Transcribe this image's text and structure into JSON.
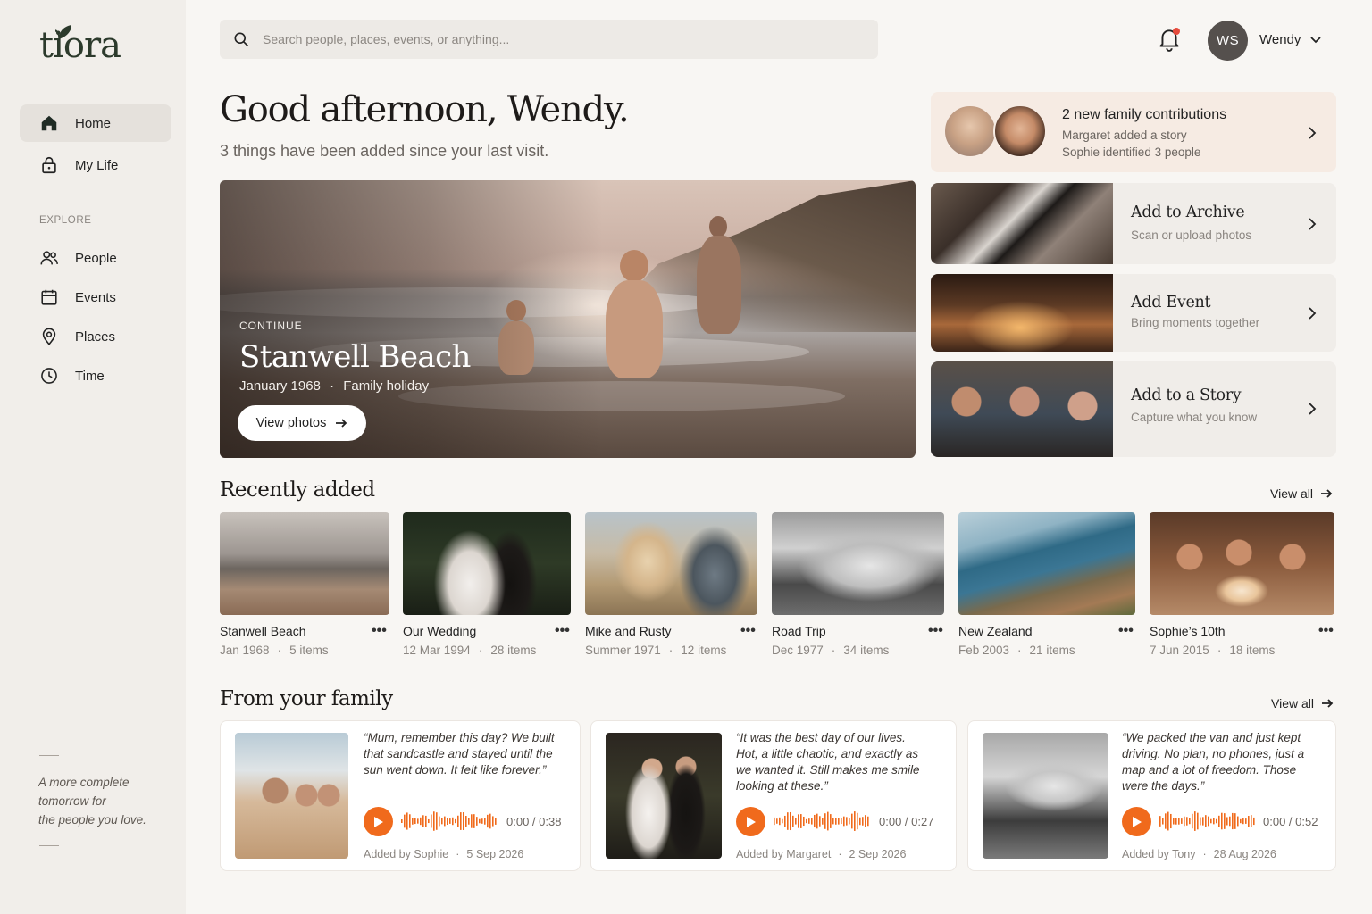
{
  "app": {
    "logo": "tiora"
  },
  "sidebar": {
    "items": [
      {
        "label": "Home",
        "icon": "home-icon"
      },
      {
        "label": "My Life",
        "icon": "lock-icon"
      }
    ],
    "explore_label": "EXPLORE",
    "explore_items": [
      {
        "label": "People",
        "icon": "people-icon"
      },
      {
        "label": "Events",
        "icon": "calendar-icon"
      },
      {
        "label": "Places",
        "icon": "map-pin-icon"
      },
      {
        "label": "Time",
        "icon": "clock-icon"
      }
    ],
    "tagline": [
      "A more complete",
      "tomorrow for",
      "the people you love."
    ]
  },
  "search": {
    "placeholder": "Search people, places, events, or anything..."
  },
  "user": {
    "initials": "WS",
    "name": "Wendy",
    "has_notification": true
  },
  "greeting": {
    "title": "Good afternoon, Wendy.",
    "subtitle": "3 things have been added since your last visit."
  },
  "hero": {
    "eyebrow": "CONTINUE",
    "title": "Stanwell Beach",
    "date": "January 1968",
    "separator": "·",
    "tag": "Family holiday",
    "button": "View photos"
  },
  "notification": {
    "title": "2 new family contributions",
    "lines": [
      "Margaret added a story",
      "Sophie identified 3 people"
    ]
  },
  "actions": [
    {
      "title": "Add to Archive",
      "subtitle": "Scan or upload photos"
    },
    {
      "title": "Add Event",
      "subtitle": "Bring moments together"
    },
    {
      "title": "Add to a Story",
      "subtitle": "Capture what you know"
    }
  ],
  "recent": {
    "title": "Recently added",
    "view_all": "View all",
    "items": [
      {
        "name": "Stanwell Beach",
        "date": "Jan 1968",
        "count": "5 items"
      },
      {
        "name": "Our Wedding",
        "date": "12 Mar 1994",
        "count": "28 items"
      },
      {
        "name": "Mike and Rusty",
        "date": "Summer 1971",
        "count": "12 items"
      },
      {
        "name": "Road Trip",
        "date": "Dec 1977",
        "count": "34 items"
      },
      {
        "name": "New Zealand",
        "date": "Feb 2003",
        "count": "21 items"
      },
      {
        "name": "Sophie’s 10th",
        "date": "7 Jun 2015",
        "count": "18 items"
      }
    ],
    "more_glyph": "•••"
  },
  "family": {
    "title": "From your family",
    "view_all": "View all",
    "items": [
      {
        "quote": "“Mum, remember this day? We built that sandcastle and stayed until the sun went down. It felt like forever.”",
        "time": "0:00 / 0:38",
        "added_by": "Added by Sophie",
        "date": "5 Sep 2026"
      },
      {
        "quote": "“It was the best day of our lives. Hot, a little chaotic, and exactly as we wanted it. Still makes me smile looking at these.”",
        "time": "0:00 / 0:27",
        "added_by": "Added by Margaret",
        "date": "2 Sep 2026"
      },
      {
        "quote": "“We packed the van and just kept driving. No plan, no phones, just a map and a lot of freedom. Those were the days.”",
        "time": "0:00 / 0:52",
        "added_by": "Added by Tony",
        "date": "28 Aug 2026"
      }
    ]
  },
  "colors": {
    "accent": "#f06a1c",
    "brand": "#2c3a2c",
    "notification_dot": "#e54b3c"
  }
}
